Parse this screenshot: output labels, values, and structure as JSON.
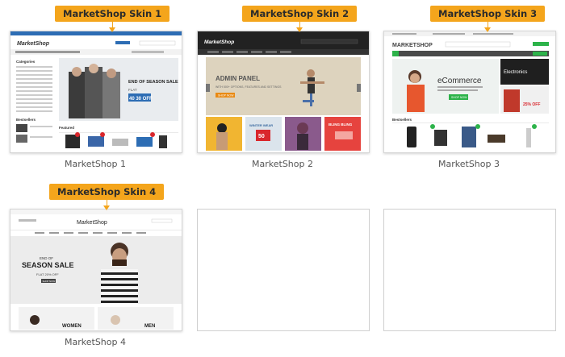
{
  "skins": [
    {
      "tag": "MarketShop Skin 1",
      "caption": "MarketShop 1",
      "logo": "MarketShop",
      "promo_title": "END OF SEASON SALE",
      "promo_flat": "FLAT",
      "promo_off": "40 30 OFF",
      "sections": [
        "Categories",
        "Featured",
        "Bestsellers"
      ]
    },
    {
      "tag": "MarketShop Skin 2",
      "caption": "MarketShop 2",
      "logo": "MarketShop",
      "promo_title": "ADMIN PANEL",
      "promo_sub": "WITH 500+ OPTIONS, FEATURES AND SETTINGS",
      "promo_btn": "SHOP NOW",
      "tiles": [
        "WINTER WEAR",
        "50",
        "BLING BLING"
      ]
    },
    {
      "tag": "MarketShop Skin 3",
      "caption": "MarketShop 3",
      "logo": "MARKETSHOP",
      "promo_title": "eCommerce",
      "promo_btn": "SHOP NOW",
      "side_title": "Electronics",
      "side_sale": "25% OFF",
      "sections": [
        "Bestsellers"
      ]
    },
    {
      "tag": "MarketShop Skin 4",
      "caption": "MarketShop 4",
      "logo": "MarketShop",
      "promo_top": "END OF",
      "promo_title": "SEASON SALE",
      "promo_flat": "FLAT 20% OFF",
      "promo_btn": "SHOP NOW",
      "women": "WOMEN",
      "men": "MEN"
    }
  ],
  "colors": {
    "tag": "#f4a51c",
    "skin1_nav": "#2d6db4",
    "skin2_top": "#222222",
    "skin2_red": "#d9262c",
    "skin3_green": "#2db34a"
  }
}
